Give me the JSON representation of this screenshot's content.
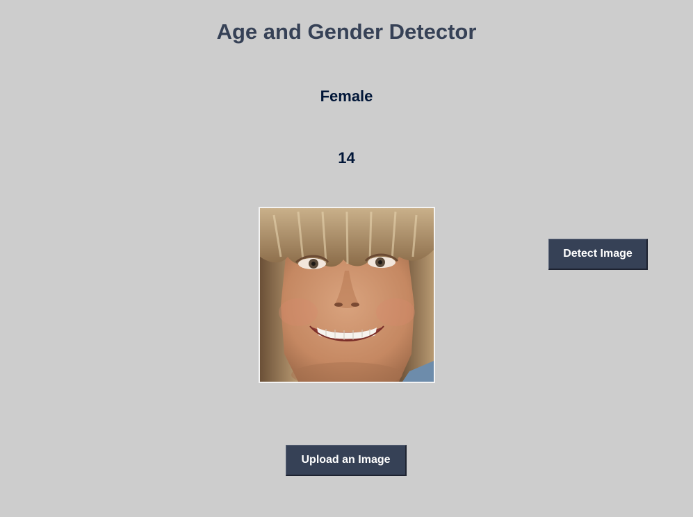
{
  "app": {
    "title": "Age and Gender Detector"
  },
  "result": {
    "gender": "Female",
    "age": "14"
  },
  "buttons": {
    "detect_label": "Detect Image",
    "upload_label": "Upload an Image"
  },
  "colors": {
    "background": "#cdcdcd",
    "title": "#364156",
    "result_text": "#011638",
    "button_bg": "#364156",
    "button_text": "#ffffff"
  }
}
